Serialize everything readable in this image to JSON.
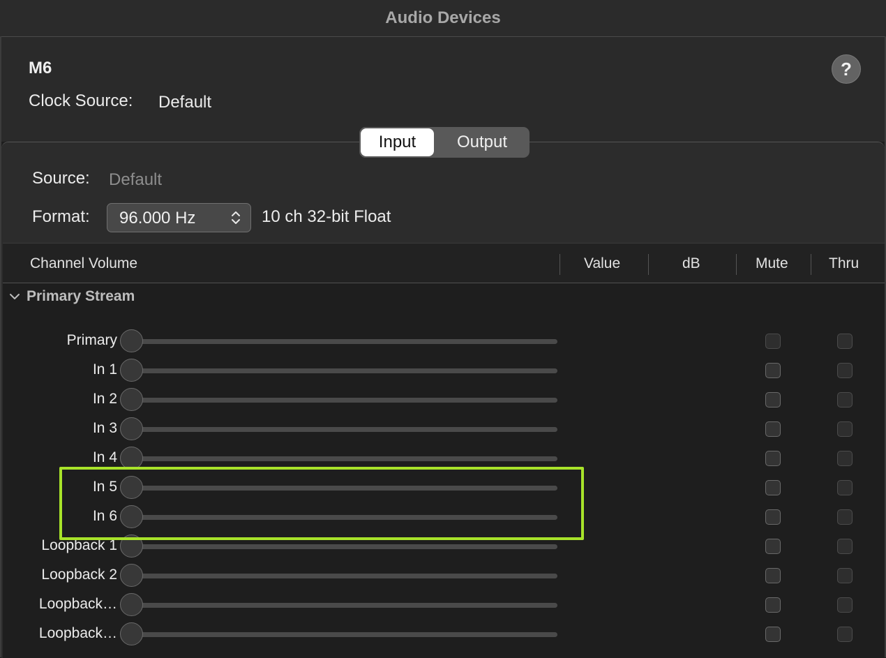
{
  "window": {
    "title": "Audio Devices"
  },
  "device": {
    "name": "M6",
    "clock_source_label": "Clock Source:",
    "clock_source_value": "Default",
    "help_glyph": "?"
  },
  "segmented": {
    "input_label": "Input",
    "output_label": "Output",
    "selected": "Input"
  },
  "io": {
    "source_label": "Source:",
    "source_value": "Default",
    "format_label": "Format:",
    "format_value": "96.000 Hz",
    "format_desc": "10 ch 32-bit Float"
  },
  "table": {
    "columns": {
      "channel_volume": "Channel Volume",
      "value": "Value",
      "db": "dB",
      "mute": "Mute",
      "thru": "Thru"
    },
    "group": {
      "label": "Primary Stream",
      "expanded": true
    },
    "rows": [
      {
        "label": "Primary",
        "volume": 0,
        "mute": false,
        "thru": false
      },
      {
        "label": "In 1",
        "volume": 0,
        "mute": false,
        "thru": false
      },
      {
        "label": "In 2",
        "volume": 0,
        "mute": false,
        "thru": false
      },
      {
        "label": "In 3",
        "volume": 0,
        "mute": false,
        "thru": false
      },
      {
        "label": "In 4",
        "volume": 0,
        "mute": false,
        "thru": false
      },
      {
        "label": "In 5",
        "volume": 0,
        "mute": false,
        "thru": false
      },
      {
        "label": "In 6",
        "volume": 0,
        "mute": false,
        "thru": false
      },
      {
        "label": "Loopback 1",
        "volume": 0,
        "mute": false,
        "thru": false
      },
      {
        "label": "Loopback 2",
        "volume": 0,
        "mute": false,
        "thru": false
      },
      {
        "label": "Loopback…",
        "volume": 0,
        "mute": false,
        "thru": false
      },
      {
        "label": "Loopback…",
        "volume": 0,
        "mute": false,
        "thru": false
      }
    ]
  },
  "colors": {
    "highlight": "#a8e32a",
    "background": "#1e1e1e",
    "panel": "#2c2c2c"
  },
  "icons": {
    "help": "question-icon",
    "format_stepper": "up-down-chevron-icon",
    "group_disclosure": "chevron-down-icon"
  }
}
